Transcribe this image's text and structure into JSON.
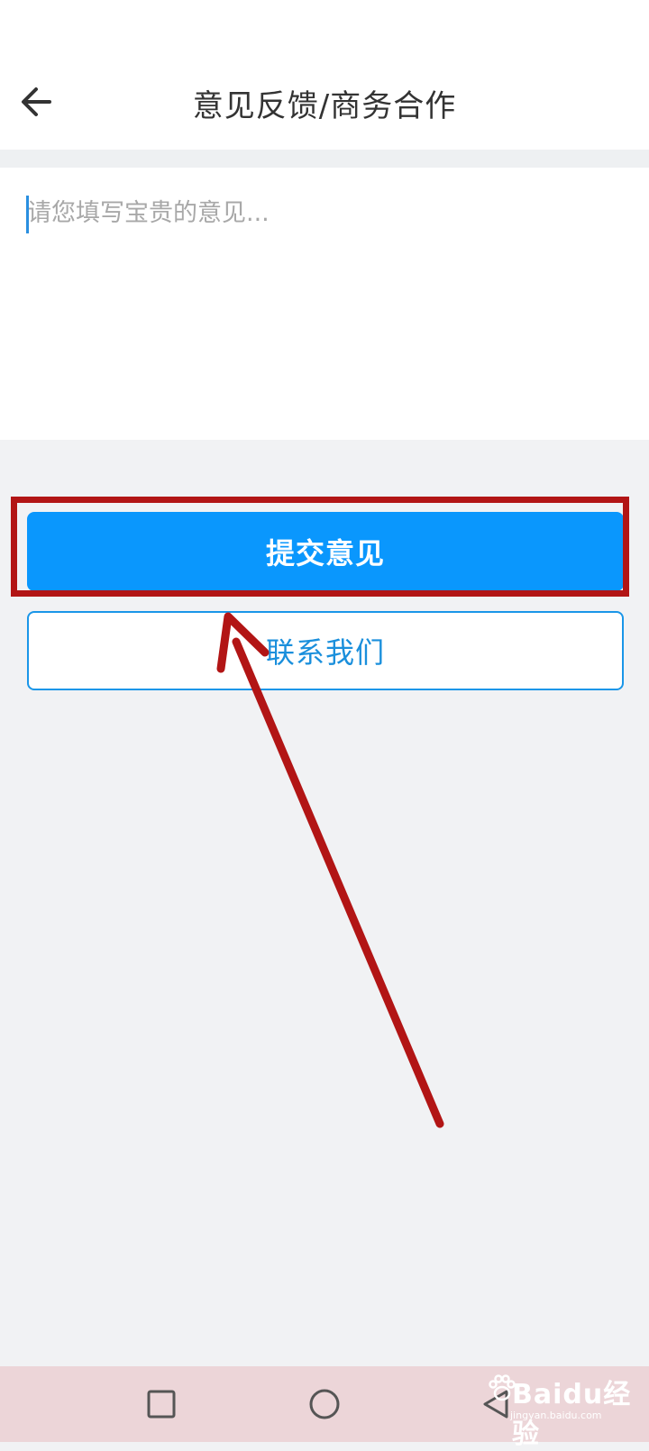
{
  "header": {
    "title": "意见反馈/商务合作",
    "back_icon": "arrow-left-icon"
  },
  "feedback": {
    "placeholder": "请您填写宝贵的意见..."
  },
  "actions": {
    "submit_label": "提交意见",
    "contact_label": "联系我们"
  },
  "nav": {
    "recents_icon": "square-icon",
    "home_icon": "circle-icon",
    "back_icon": "triangle-back-icon"
  },
  "watermark": {
    "brand": "Baidu经验",
    "url": "jingyan.baidu.com"
  },
  "colors": {
    "primary": "#0a97fd",
    "annotation": "#b21515",
    "background": "#f1f2f4"
  }
}
